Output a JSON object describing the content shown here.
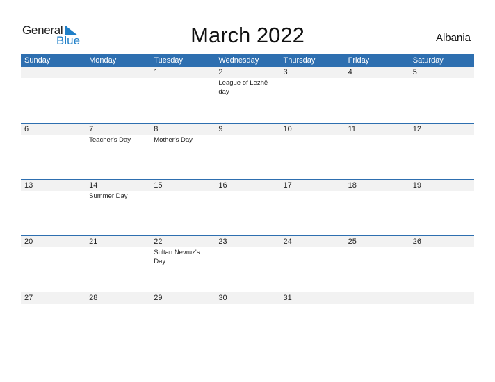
{
  "logo": {
    "general": "General",
    "blue": "Blue",
    "icon": "triangle-flag-icon",
    "brand_color": "#1f7fc8"
  },
  "title": "March 2022",
  "country": "Albania",
  "colors": {
    "header_bg": "#2e6fb0",
    "date_band": "#f2f2f2"
  },
  "weekdays": [
    "Sunday",
    "Monday",
    "Tuesday",
    "Wednesday",
    "Thursday",
    "Friday",
    "Saturday"
  ],
  "weeks": [
    [
      {
        "day": "",
        "event": ""
      },
      {
        "day": "",
        "event": ""
      },
      {
        "day": "1",
        "event": ""
      },
      {
        "day": "2",
        "event": "League of Lezhë day"
      },
      {
        "day": "3",
        "event": ""
      },
      {
        "day": "4",
        "event": ""
      },
      {
        "day": "5",
        "event": ""
      }
    ],
    [
      {
        "day": "6",
        "event": ""
      },
      {
        "day": "7",
        "event": "Teacher's Day"
      },
      {
        "day": "8",
        "event": "Mother's Day"
      },
      {
        "day": "9",
        "event": ""
      },
      {
        "day": "10",
        "event": ""
      },
      {
        "day": "11",
        "event": ""
      },
      {
        "day": "12",
        "event": ""
      }
    ],
    [
      {
        "day": "13",
        "event": ""
      },
      {
        "day": "14",
        "event": "Summer Day"
      },
      {
        "day": "15",
        "event": ""
      },
      {
        "day": "16",
        "event": ""
      },
      {
        "day": "17",
        "event": ""
      },
      {
        "day": "18",
        "event": ""
      },
      {
        "day": "19",
        "event": ""
      }
    ],
    [
      {
        "day": "20",
        "event": ""
      },
      {
        "day": "21",
        "event": ""
      },
      {
        "day": "22",
        "event": "Sultan Nevruz's Day"
      },
      {
        "day": "23",
        "event": ""
      },
      {
        "day": "24",
        "event": ""
      },
      {
        "day": "25",
        "event": ""
      },
      {
        "day": "26",
        "event": ""
      }
    ],
    [
      {
        "day": "27",
        "event": ""
      },
      {
        "day": "28",
        "event": ""
      },
      {
        "day": "29",
        "event": ""
      },
      {
        "day": "30",
        "event": ""
      },
      {
        "day": "31",
        "event": ""
      },
      {
        "day": "",
        "event": ""
      },
      {
        "day": "",
        "event": ""
      }
    ]
  ]
}
